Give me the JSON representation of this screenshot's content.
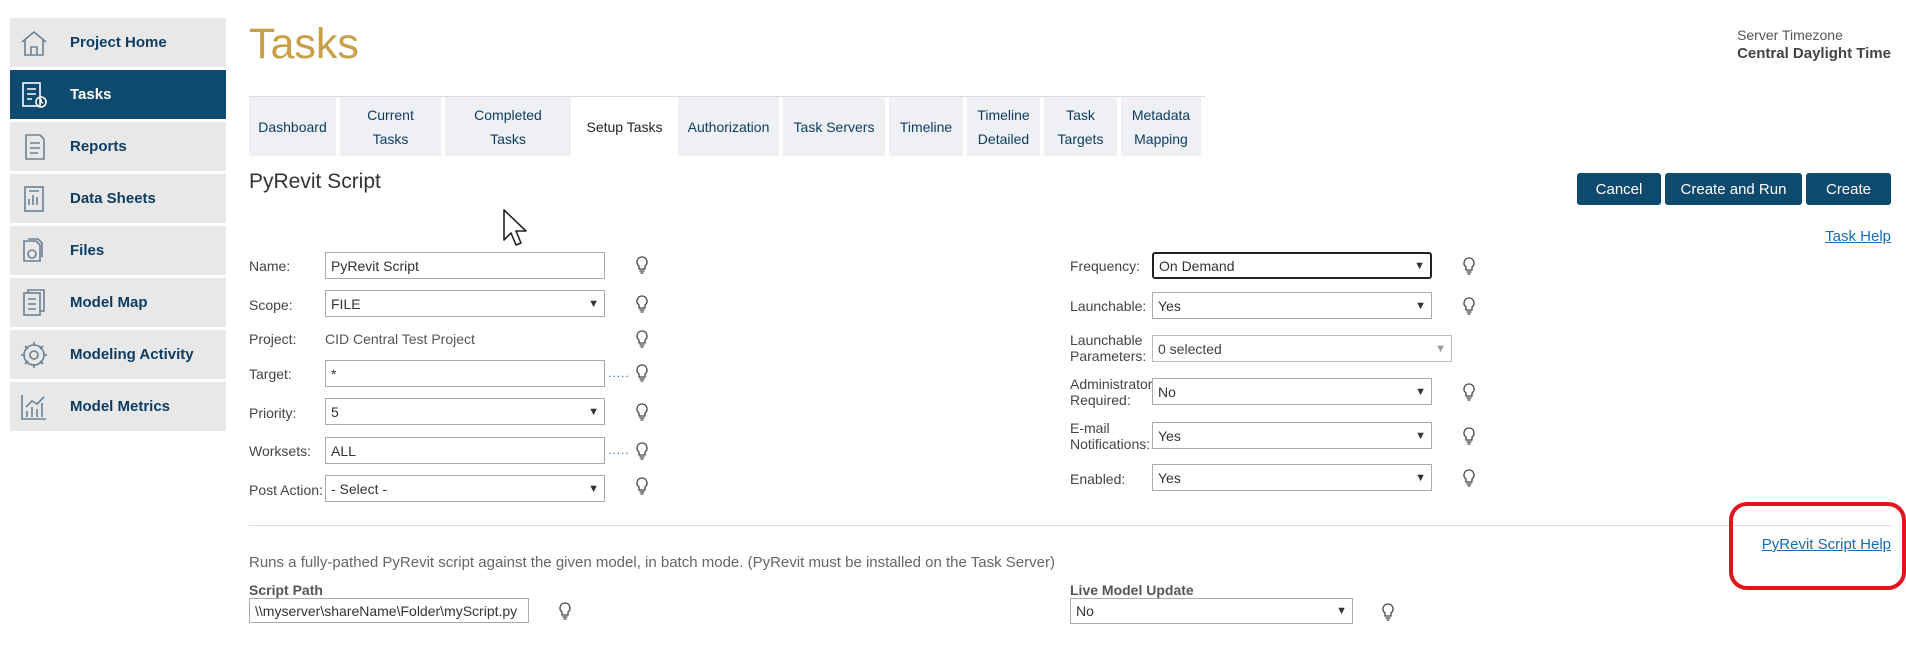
{
  "sidebar": {
    "items": [
      {
        "label": "Project Home",
        "icon": "home-icon"
      },
      {
        "label": "Tasks",
        "icon": "tasks-icon",
        "active": true
      },
      {
        "label": "Reports",
        "icon": "reports-icon"
      },
      {
        "label": "Data Sheets",
        "icon": "data-sheets-icon"
      },
      {
        "label": "Files",
        "icon": "files-icon"
      },
      {
        "label": "Model Map",
        "icon": "model-map-icon"
      },
      {
        "label": "Modeling Activity",
        "icon": "modeling-activity-icon"
      },
      {
        "label": "Model Metrics",
        "icon": "model-metrics-icon"
      }
    ]
  },
  "header": {
    "title": "Tasks",
    "timezone_label": "Server Timezone",
    "timezone_value": "Central Daylight Time"
  },
  "tabs": [
    {
      "label": "Dashboard"
    },
    {
      "label": "Current Tasks"
    },
    {
      "label": "Completed Tasks"
    },
    {
      "label": "Setup Tasks",
      "active": true
    },
    {
      "label": "Authorization"
    },
    {
      "label": "Task Servers"
    },
    {
      "label": "Timeline"
    },
    {
      "label": "Timeline\nDetailed"
    },
    {
      "label": "Task\nTargets"
    },
    {
      "label": "Metadata\nMapping"
    }
  ],
  "form": {
    "section_title": "PyRevit Script",
    "buttons": {
      "cancel": "Cancel",
      "create_and_run": "Create and Run",
      "create": "Create"
    },
    "task_help": "Task Help",
    "left": {
      "name_label": "Name:",
      "name_value": "PyRevit Script",
      "scope_label": "Scope:",
      "scope_value": "FILE",
      "project_label": "Project:",
      "project_value": "CID Central Test Project",
      "target_label": "Target:",
      "target_value": "*",
      "priority_label": "Priority:",
      "priority_value": "5",
      "worksets_label": "Worksets:",
      "worksets_value": "ALL",
      "post_action_label": "Post Action:",
      "post_action_value": "- Select -",
      "dots": "....."
    },
    "right": {
      "frequency_label": "Frequency:",
      "frequency_value": "On Demand",
      "launchable_label": "Launchable:",
      "launchable_value": "Yes",
      "launchable_params_label": "Launchable\nParameters:",
      "launchable_params_value": "0 selected",
      "admin_label": "Administrator\nRequired:",
      "admin_value": "No",
      "email_label": "E-mail\nNotifications:",
      "email_value": "Yes",
      "enabled_label": "Enabled:",
      "enabled_value": "Yes"
    },
    "script_help": "PyRevit Script Help",
    "description": "Runs a fully-pathed PyRevit script against the given model, in batch mode. (PyRevit must be installed on the Task Server)",
    "script_path_label": "Script Path",
    "script_path_value": "\\\\myserver\\shareName\\Folder\\myScript.py",
    "live_update_label": "Live Model Update",
    "live_update_value": "No"
  },
  "colors": {
    "accent": "#0d4a6e",
    "title": "#c8a04a",
    "link": "#1a6bb0",
    "highlight": "#e3141b"
  }
}
